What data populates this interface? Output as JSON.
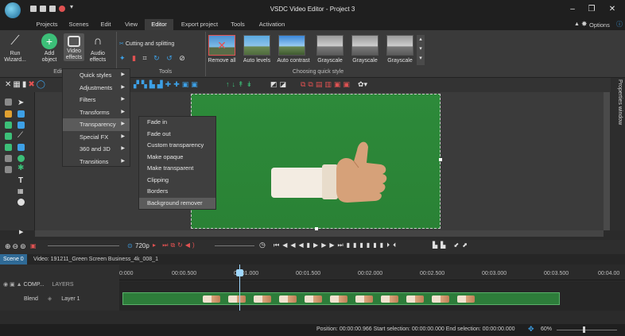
{
  "window": {
    "title": "VSDC Video Editor - Project 3",
    "controls": [
      "–",
      "❐",
      "✕"
    ]
  },
  "menu_tabs": [
    {
      "label": "Projects"
    },
    {
      "label": "Scenes"
    },
    {
      "label": "Edit"
    },
    {
      "label": "View"
    },
    {
      "label": "Editor",
      "active": true
    },
    {
      "label": "Export project"
    },
    {
      "label": "Tools"
    },
    {
      "label": "Activation"
    }
  ],
  "options_label": "Options",
  "ribbon": {
    "run_wizard": "Run\nWizard...",
    "run_wizard_l1": "Run",
    "run_wizard_l2": "Wizard...",
    "add_object_l1": "Add",
    "add_object_l2": "object",
    "video_effects_l1": "Video",
    "video_effects_l2": "effects",
    "audio_effects_l1": "Audio",
    "audio_effects_l2": "effects",
    "group_editing": "Editi",
    "cutting_and_splitting": "Cutting and splitting",
    "group_tools": "Tools",
    "quick_styles": [
      {
        "label": "Remove all"
      },
      {
        "label": "Auto levels"
      },
      {
        "label": "Auto contrast"
      },
      {
        "label": "Grayscale"
      },
      {
        "label": "Grayscale"
      },
      {
        "label": "Grayscale"
      }
    ],
    "group_quick_styles": "Choosing quick style"
  },
  "effects_menu": [
    {
      "label": "Quick styles"
    },
    {
      "label": "Adjustments"
    },
    {
      "label": "Filters"
    },
    {
      "label": "Transforms"
    },
    {
      "label": "Transparency",
      "highlighted": true
    },
    {
      "label": "Special FX"
    },
    {
      "label": "360 and 3D"
    },
    {
      "label": "Transitions"
    }
  ],
  "transparency_submenu": [
    {
      "label": "Fade in"
    },
    {
      "label": "Fade out"
    },
    {
      "label": "Custom transparency"
    },
    {
      "label": "Make opaque"
    },
    {
      "label": "Make transparent"
    },
    {
      "label": "Clipping"
    },
    {
      "label": "Borders"
    },
    {
      "label": "Background remover",
      "highlighted": true
    }
  ],
  "properties_window": "Properties window",
  "timeline": {
    "resolution": "720p",
    "tabs": [
      {
        "label": "Scene 0"
      },
      {
        "label": "Video: 191211_Green Screen Business_4k_008_1"
      }
    ],
    "ruler": [
      "0:000",
      "00:00.500",
      "00:01.000",
      "00:01.500",
      "00:02.000",
      "00:02.500",
      "00:03.000",
      "00:03.500",
      "00:04.00"
    ],
    "comp_label": "COMP...",
    "layers_label": "LAYERS",
    "blend_label": "Blend",
    "layer_name": "Layer 1"
  },
  "status": {
    "position_label": "Position:",
    "position_value": "00:00:00.966",
    "start_label": "Start selection:",
    "start_value": "00:00:00.000",
    "end_label": "End selection:",
    "end_value": "00:00:00.000",
    "zoom": "60%"
  },
  "colors": {
    "green_screen": "#2a8637",
    "accent_blue": "#3da0e6",
    "menu_highlight": "#5b5b5b"
  }
}
